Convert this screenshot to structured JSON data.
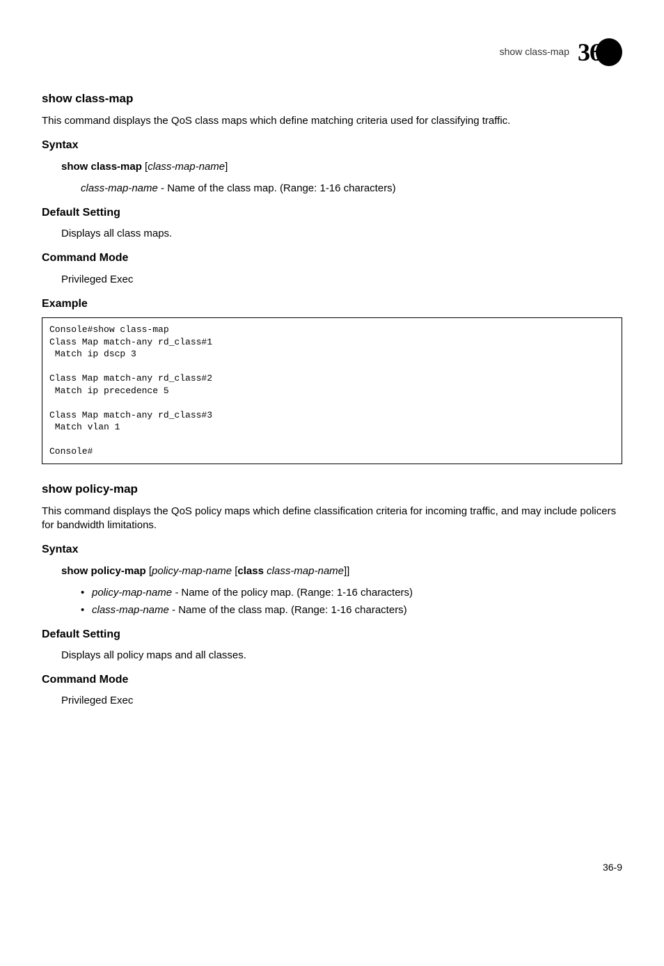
{
  "header": {
    "text": "show class-map",
    "chapter": "36"
  },
  "section1": {
    "title": "show class-map",
    "desc": "This command displays the QoS class maps which define matching criteria used for classifying traffic.",
    "syntax_title": "Syntax",
    "syntax_cmd_bold": "show class-map",
    "syntax_cmd_italic": "class-map-name",
    "param_italic": "class-map-name",
    "param_rest": " - Name of the class map. (Range: 1-16 characters)",
    "default_title": "Default Setting",
    "default_text": "Displays all class maps.",
    "mode_title": "Command Mode",
    "mode_text": "Privileged Exec",
    "example_title": "Example",
    "code": "Console#show class-map \nClass Map match-any rd_class#1\n Match ip dscp 3\n\nClass Map match-any rd_class#2\n Match ip precedence 5\n\nClass Map match-any rd_class#3\n Match vlan 1\n\nConsole#"
  },
  "section2": {
    "title": "show policy-map",
    "desc": "This command displays the QoS policy maps which define classification criteria for incoming traffic, and may include policers for bandwidth limitations.",
    "syntax_title": "Syntax",
    "syntax_cmd_bold1": "show policy-map",
    "syntax_cmd_italic1": "policy-map-name",
    "syntax_cmd_bold2": "class",
    "syntax_cmd_italic2": "class-map-name",
    "bullet1_italic": "policy-map-name - ",
    "bullet1_rest": "Name of the policy map. (Range: 1-16 characters)",
    "bullet2_italic": "class-map-name",
    "bullet2_rest": " - Name of the class map. (Range: 1-16 characters)",
    "default_title": "Default Setting",
    "default_text": "Displays all policy maps and all classes.",
    "mode_title": "Command Mode",
    "mode_text": "Privileged Exec"
  },
  "page_number": "36-9"
}
